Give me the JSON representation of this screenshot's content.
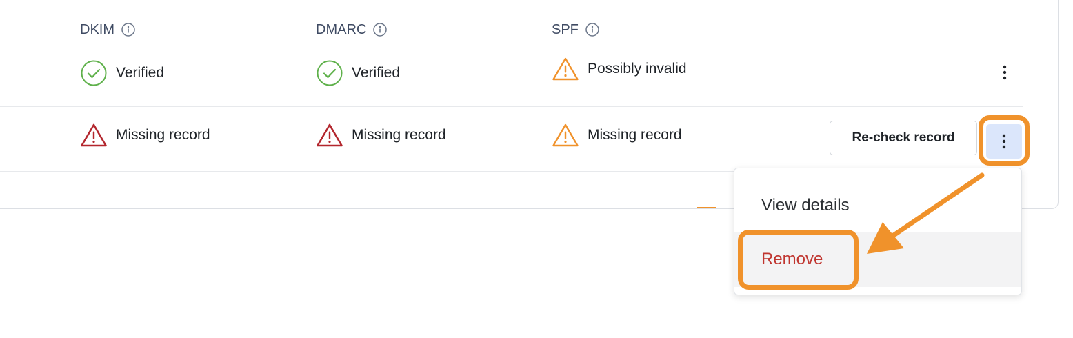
{
  "columns": [
    {
      "label": "DKIM"
    },
    {
      "label": "DMARC"
    },
    {
      "label": "SPF"
    }
  ],
  "rows": [
    {
      "dkim": {
        "status": "Verified",
        "icon": "check-circle-icon"
      },
      "dmarc": {
        "status": "Verified",
        "icon": "check-circle-icon"
      },
      "spf": {
        "status": "Possibly invalid",
        "icon": "warning-orange-icon"
      }
    },
    {
      "dkim": {
        "status": "Missing record",
        "icon": "warning-red-icon"
      },
      "dmarc": {
        "status": "Missing record",
        "icon": "warning-red-icon"
      },
      "spf": {
        "status": "Missing record",
        "icon": "warning-orange-icon"
      },
      "action_label": "Re-check record"
    }
  ],
  "menu": {
    "items": [
      {
        "label": "View details"
      },
      {
        "label": "Remove"
      }
    ]
  },
  "colors": {
    "verified": "#5fb14b",
    "error": "#b3262d",
    "warning": "#f0922b",
    "highlight": "#f0922b",
    "danger_text": "#c0352f",
    "active_kebab_bg": "#dbe6fb"
  }
}
